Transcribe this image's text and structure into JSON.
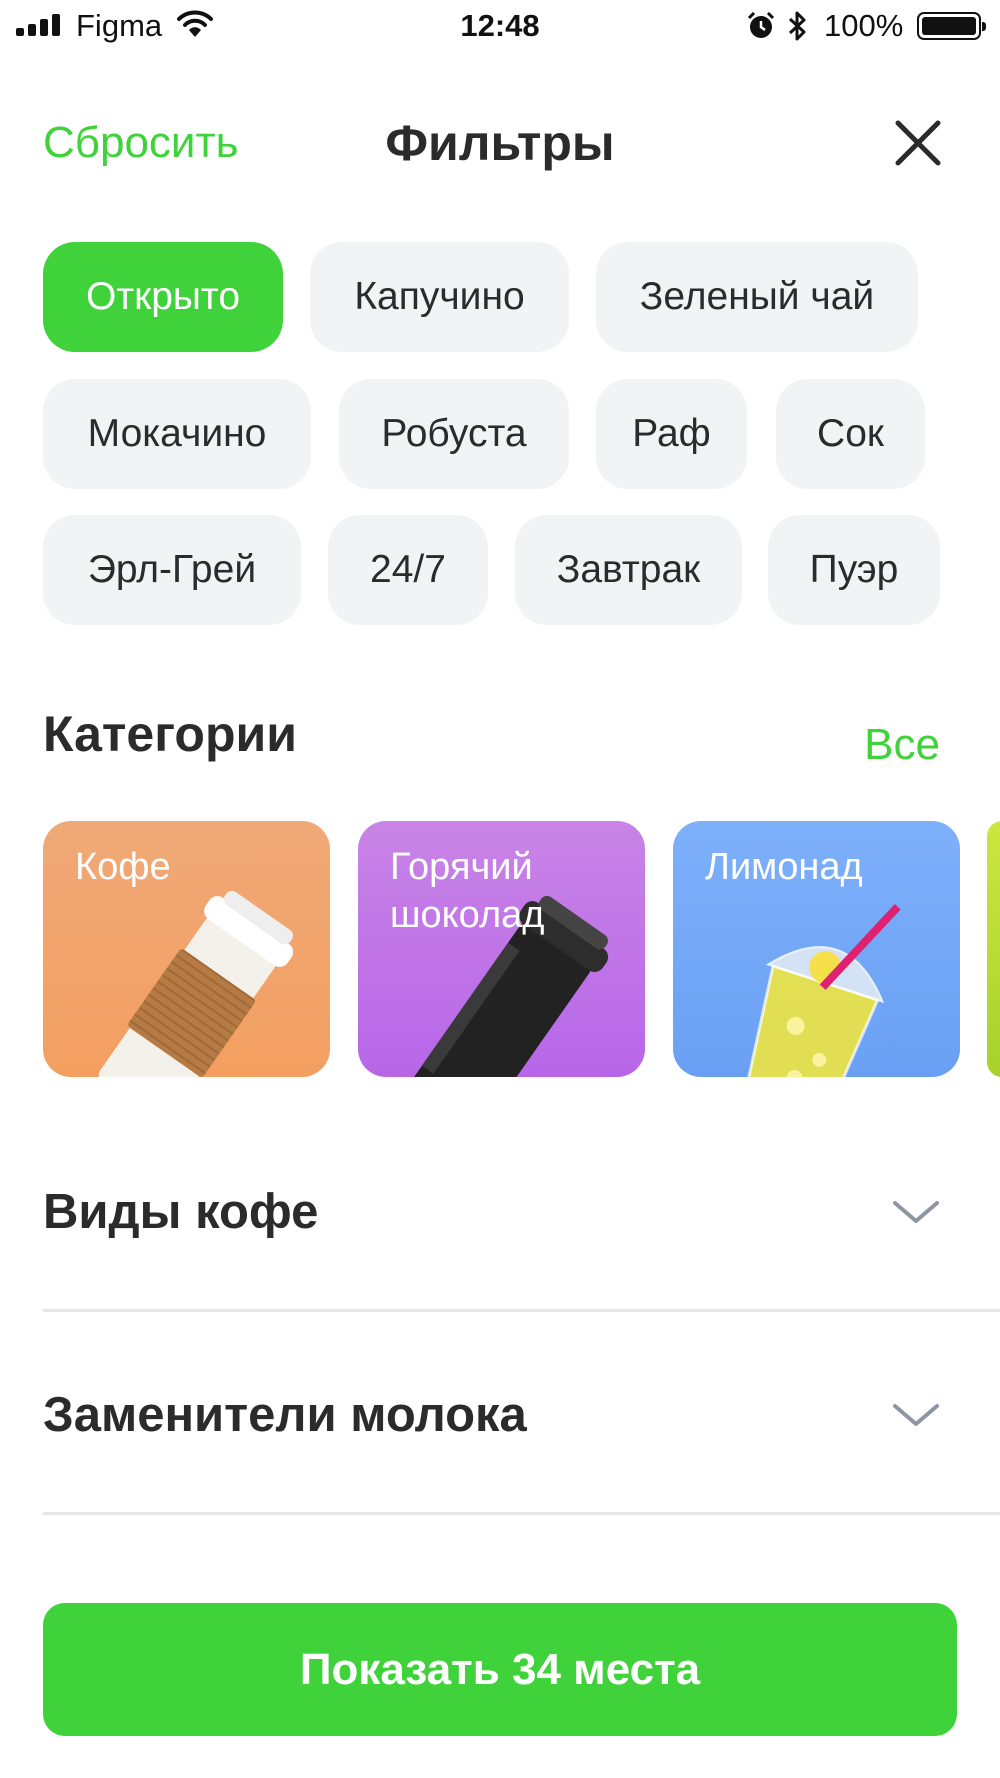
{
  "status_bar": {
    "carrier": "Figma",
    "time": "12:48",
    "battery_percent": "100%",
    "battery_level": 1.0,
    "icons": [
      "signal-icon",
      "wifi-icon",
      "alarm-icon",
      "bluetooth-icon",
      "battery-icon"
    ]
  },
  "header": {
    "reset_label": "Сбросить",
    "title": "Фильтры",
    "close_icon": "close-icon"
  },
  "chips": [
    {
      "label": "Открыто",
      "active": true
    },
    {
      "label": "Капучино",
      "active": false
    },
    {
      "label": "Зеленый чай",
      "active": false
    },
    {
      "label": "Мокачино",
      "active": false
    },
    {
      "label": "Робуста",
      "active": false
    },
    {
      "label": "Раф",
      "active": false
    },
    {
      "label": "Сок",
      "active": false
    },
    {
      "label": "Эрл-Грей",
      "active": false
    },
    {
      "label": "24/7",
      "active": false
    },
    {
      "label": "Завтрак",
      "active": false
    },
    {
      "label": "Пуэр",
      "active": false
    }
  ],
  "categories": {
    "title": "Категории",
    "see_all": "Все",
    "items": [
      {
        "label": "Кофе",
        "image": "coffee-cup-image"
      },
      {
        "label": "Горячий\nшоколад",
        "image": "black-cup-image"
      },
      {
        "label": "Лимонад",
        "image": "lemonade-cup-image"
      }
    ]
  },
  "accordions": [
    {
      "title": "Виды кофе",
      "icon": "chevron-down-icon"
    },
    {
      "title": "Заменители молока",
      "icon": "chevron-down-icon"
    }
  ],
  "footer": {
    "show_button": "Показать 34 места"
  },
  "colors": {
    "accent": "#3fd23a",
    "chip_bg": "#f2f3f5",
    "text": "#2b2b2b",
    "card_coffee": "#f2a36e",
    "card_chocolate": "#b86ee6",
    "card_lemonade": "#72a6f7"
  }
}
